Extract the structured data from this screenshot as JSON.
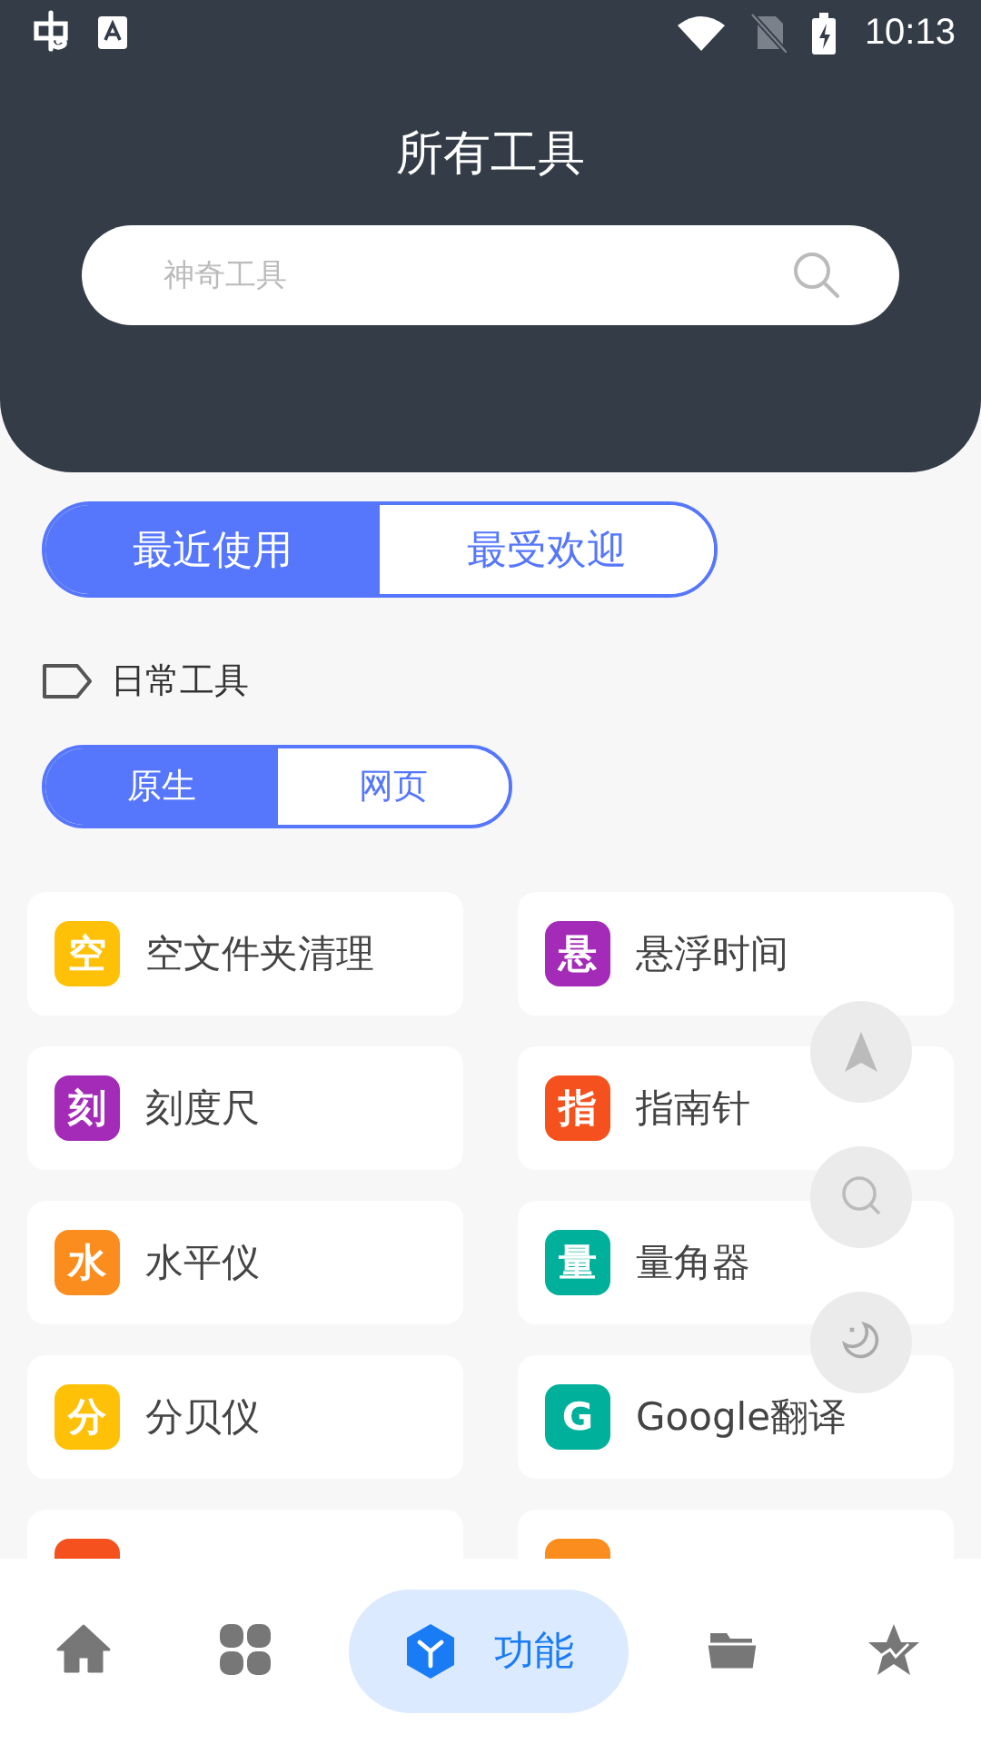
{
  "status_bar": {
    "time": "10:13"
  },
  "header": {
    "title": "所有工具",
    "search": {
      "placeholder": "神奇工具"
    }
  },
  "tabs": [
    {
      "label": "最近使用",
      "selected": true
    },
    {
      "label": "最受欢迎",
      "selected": false
    }
  ],
  "section": {
    "label": "日常工具"
  },
  "subtabs": [
    {
      "label": "原生",
      "selected": true
    },
    {
      "label": "网页",
      "selected": false
    }
  ],
  "tools": [
    {
      "icon_text": "空",
      "name": "空文件夹清理",
      "color": "#ffc107"
    },
    {
      "icon_text": "悬",
      "name": "悬浮时间",
      "color": "#a42bb8"
    },
    {
      "icon_text": "刻",
      "name": "刻度尺",
      "color": "#a42bb8"
    },
    {
      "icon_text": "指",
      "name": "指南针",
      "color": "#f4511e"
    },
    {
      "icon_text": "水",
      "name": "水平仪",
      "color": "#fb8c1e"
    },
    {
      "icon_text": "量",
      "name": "量角器",
      "color": "#00b09b"
    },
    {
      "icon_text": "分",
      "name": "分贝仪",
      "color": "#ffc107"
    },
    {
      "icon_text": "G",
      "name": "Google翻译",
      "color": "#00b09b"
    },
    {
      "color": "#f4511e"
    },
    {
      "color": "#fb8c1e"
    }
  ],
  "side_buttons": [
    {
      "kind": "navigate"
    },
    {
      "kind": "search"
    },
    {
      "kind": "night"
    }
  ],
  "nav": [
    {
      "kind": "home",
      "selected": false
    },
    {
      "kind": "apps",
      "selected": false
    },
    {
      "kind": "tools",
      "label": "功能",
      "selected": true
    },
    {
      "kind": "folder",
      "selected": false
    },
    {
      "kind": "star",
      "selected": false
    }
  ]
}
